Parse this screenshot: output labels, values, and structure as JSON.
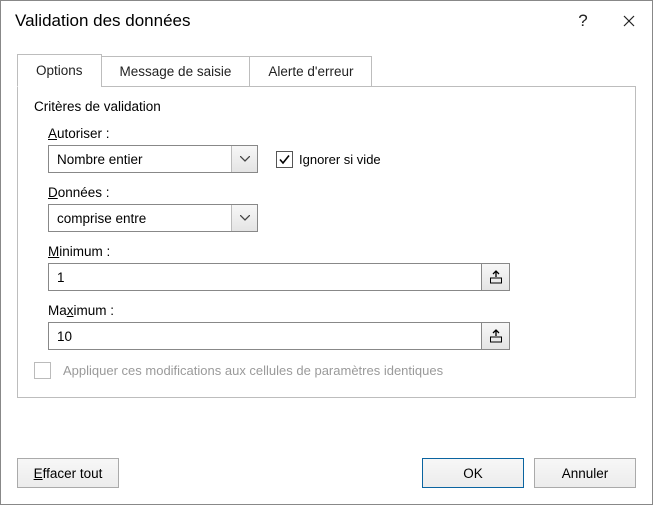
{
  "titlebar": {
    "title": "Validation des données"
  },
  "tabs": {
    "options": "Options",
    "input_msg": "Message de saisie",
    "error_alert": "Alerte d'erreur"
  },
  "panel": {
    "section_title": "Critères de validation",
    "allow_label_pre": "A",
    "allow_label_post": "utoriser :",
    "allow_value": "Nombre entier",
    "ignore_blank_label": "Ignorer si vide",
    "data_label_pre": "D",
    "data_label_post": "onnées :",
    "data_value": "comprise entre",
    "min_label_pre": "M",
    "min_label_post": "inimum :",
    "min_value": "1",
    "max_label_pre": "Ma",
    "max_label_post": "ximum :",
    "max_underline": "x",
    "max_before": "Ma",
    "max_after": "imum :",
    "apply_same": "Appliquer ces modifications aux cellules de paramètres identiques"
  },
  "footer": {
    "clear_pre": "E",
    "clear_post": "ffacer tout",
    "ok": "OK",
    "cancel": "Annuler"
  }
}
